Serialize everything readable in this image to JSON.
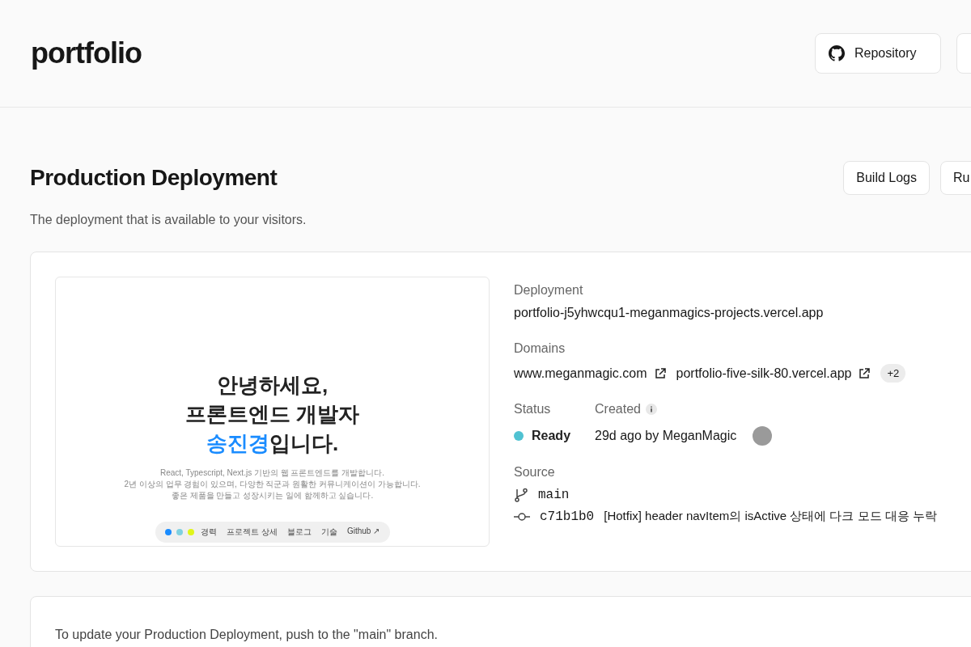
{
  "header": {
    "logo": "portfolio",
    "buttons": [
      {
        "kind": "github",
        "label": "Repository"
      },
      {
        "kind": "plain"
      }
    ]
  },
  "section": {
    "title": "Production Deployment",
    "subtitle": "The deployment that is available to your visitors.",
    "buttons": [
      "Build Logs",
      "Ru"
    ]
  },
  "preview": {
    "headline": [
      "안녕하세요,",
      "프론트엔드 개발자"
    ],
    "headline_highlight": "송진경",
    "headline_rest": "입니다.",
    "description": [
      "React, Typescript, Next.js 기반의 웹 프론트엔드를 개발합니다.",
      "2년 이상의 업무 경험이 있으며, 다양한 직군과 원활한 커뮤니케이션이 가능합니다.",
      "좋은 제품을 만들고 성장시키는 일에 함께하고 싶습니다."
    ],
    "nav": [
      "경력",
      "프로젝트 상세",
      "블로그",
      "기술",
      "Github ↗"
    ]
  },
  "details": {
    "deployment_label": "Deployment",
    "deployment": "portfolio-j5yhwcqu1-meganmagics-projects.vercel.app",
    "domains_label": "Domains",
    "domains": [
      "www.meganmagic.com",
      "portfolio-five-silk-80.vercel.app"
    ],
    "domains_more": "+2",
    "status_label": "Status",
    "status": {
      "color": "#50c2d2",
      "text": "Ready"
    },
    "created_label": "Created",
    "created": "29d ago by MeganMagic",
    "source_label": "Source",
    "branch": "main",
    "commit_hash": "c71b1b0",
    "commit_message": "[Hotfix] header navItem의 isActive 상태에 다크 모드 대응 누락"
  },
  "footer_note": "To update your Production Deployment, push to the \"main\" branch."
}
